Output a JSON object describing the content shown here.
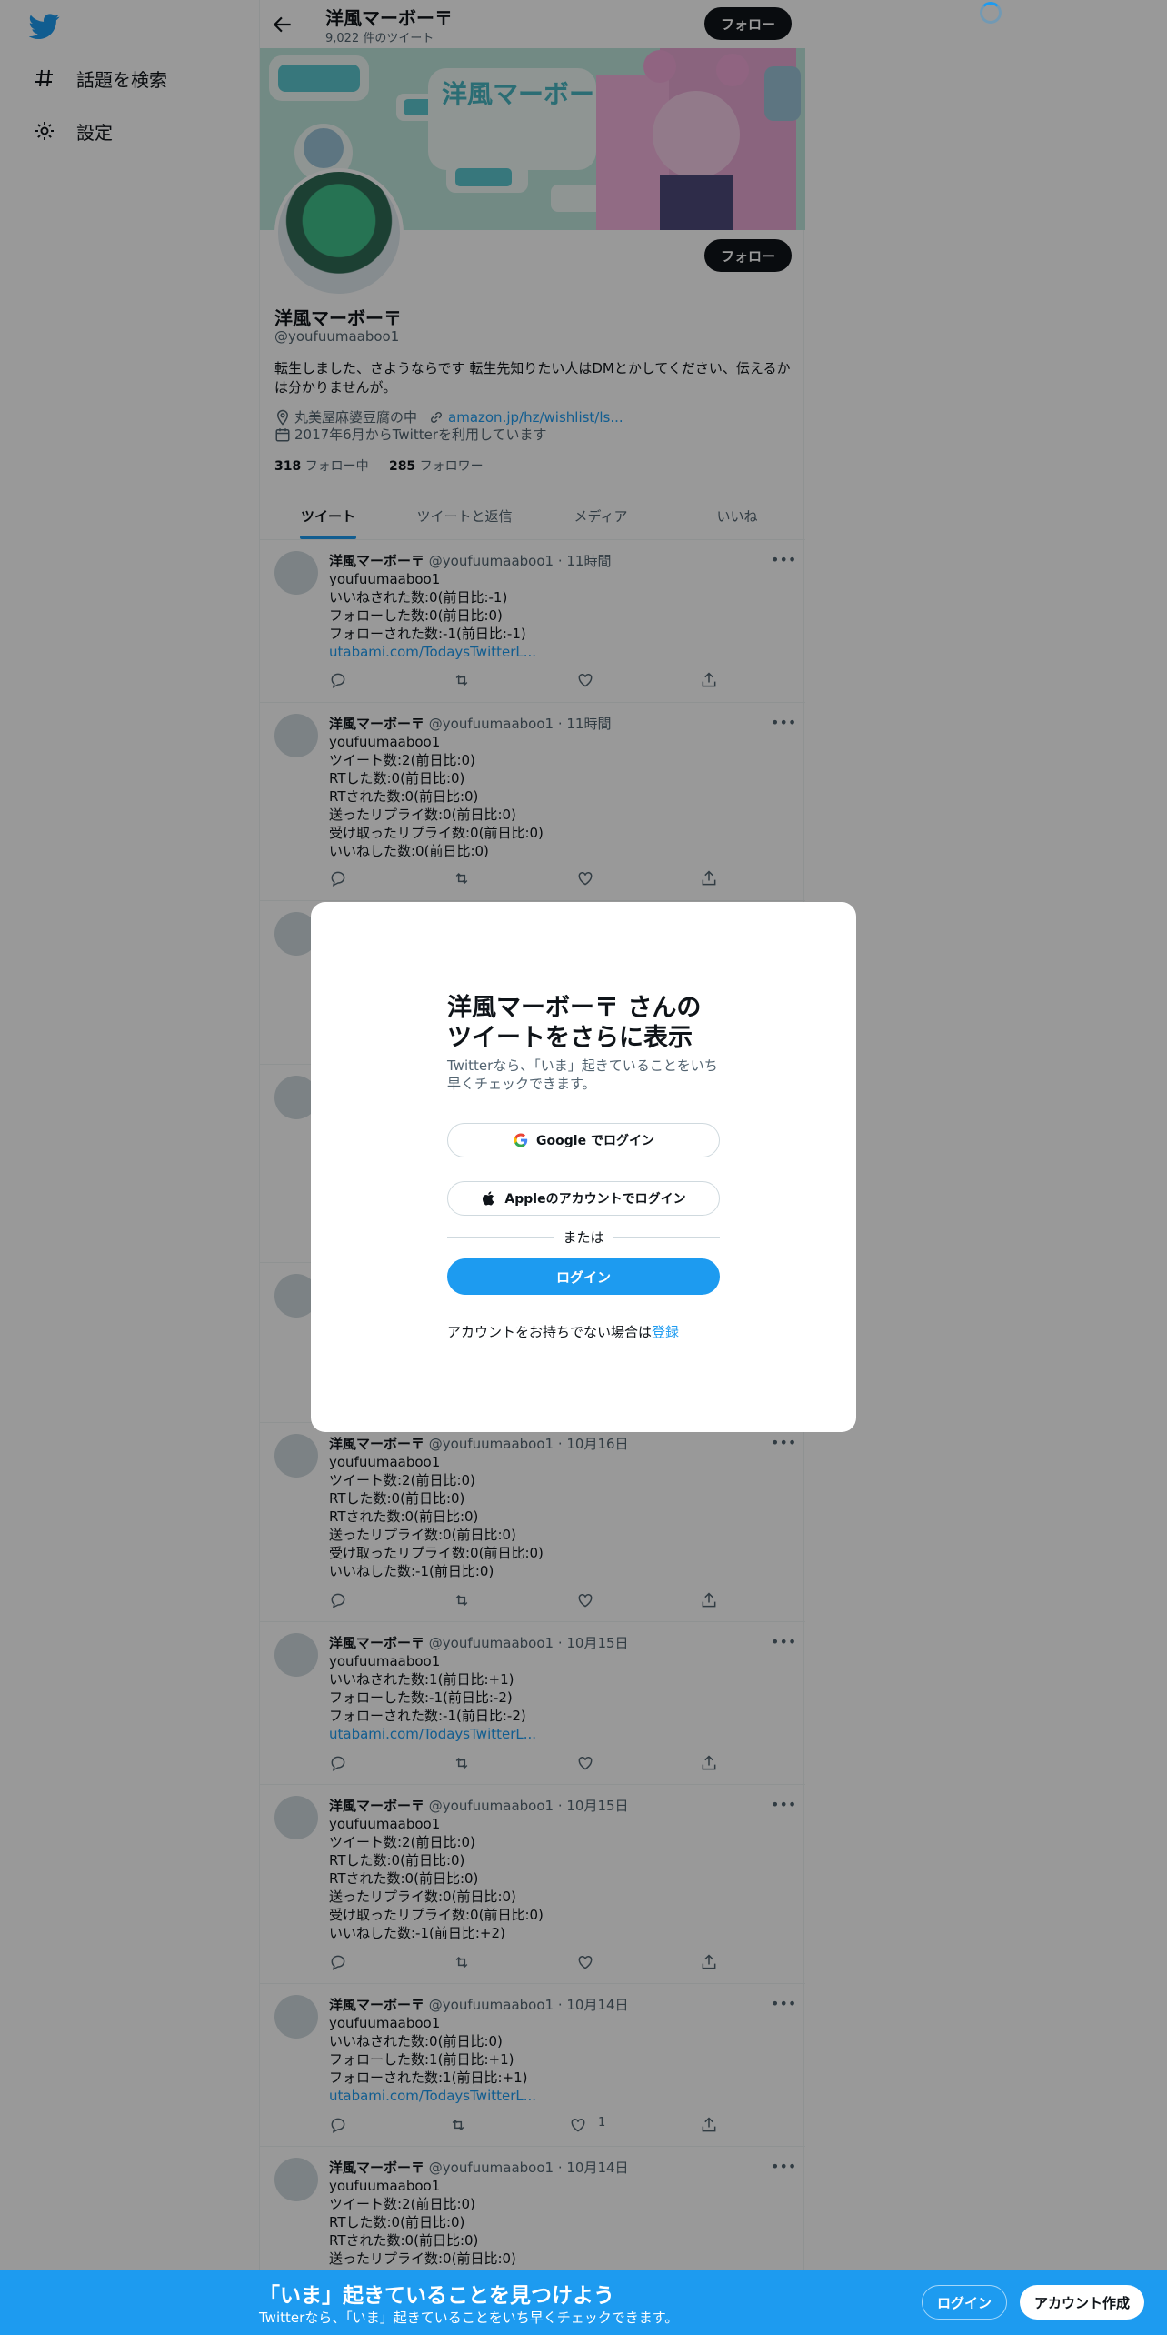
{
  "leftnav": {
    "items": [
      {
        "label": "話題を検索",
        "icon": "hashtag-icon"
      },
      {
        "label": "設定",
        "icon": "gear-icon"
      }
    ]
  },
  "topbar": {
    "name": "洋風マーボー〒",
    "tweet_count": "9,022 件のツイート",
    "follow_label": "フォロー"
  },
  "profile": {
    "name": "洋風マーボー〒",
    "handle": "@youfuumaaboo1",
    "bio": "転生しました、さようならです 転生先知りたい人はDMとかしてください、伝えるかは分かりませんが。",
    "location": "丸美屋麻婆豆腐の中",
    "link": "amazon.jp/hz/wishlist/ls...",
    "joined": "2017年6月からTwitterを利用しています",
    "following_count": "318",
    "following_label": "フォロー中",
    "followers_count": "285",
    "followers_label": "フォロワー",
    "follow_label": "フォロー",
    "banner_text": "洋風マーボー"
  },
  "tabs": [
    {
      "label": "ツイート",
      "active": true
    },
    {
      "label": "ツイートと返信",
      "active": false
    },
    {
      "label": "メディア",
      "active": false
    },
    {
      "label": "いいね",
      "active": false
    }
  ],
  "tweets": [
    {
      "name": "洋風マーボー〒",
      "meta": "@youfuumaaboo1 · 11時間",
      "lines": [
        "youfuumaaboo1",
        "いいねされた数:0(前日比:-1)",
        "フォローした数:0(前日比:0)",
        "フォローされた数:-1(前日比:-1)"
      ],
      "link": "utabami.com/TodaysTwitterL...",
      "likes": ""
    },
    {
      "name": "洋風マーボー〒",
      "meta": "@youfuumaaboo1 · 11時間",
      "lines": [
        "youfuumaaboo1",
        "ツイート数:2(前日比:0)",
        "RTした数:0(前日比:0)",
        "RTされた数:0(前日比:0)",
        "送ったリプライ数:0(前日比:0)",
        "受け取ったリプライ数:0(前日比:0)",
        "いいねした数:0(前日比:0)"
      ],
      "link": "",
      "likes": ""
    },
    {
      "name": "洋風マーボー〒",
      "meta": "@youfuumaaboo1 · 10月16日",
      "lines": [
        "youfuumaaboo1",
        "ツイート数:2(前日比:0)",
        "RTした数:0(前日比:0)",
        "RTされた数:0(前日比:0)",
        "送ったリプライ数:0(前日比:0)",
        "受け取ったリプライ数:0(前日比:0)",
        "いいねした数:-1(前日比:0)"
      ],
      "link": "",
      "likes": ""
    },
    {
      "name": "洋風マーボー〒",
      "meta": "@youfuumaaboo1 · 10月15日",
      "lines": [
        "youfuumaaboo1",
        "いいねされた数:1(前日比:+1)",
        "フォローした数:-1(前日比:-2)",
        "フォローされた数:-1(前日比:-2)"
      ],
      "link": "utabami.com/TodaysTwitterL...",
      "likes": ""
    },
    {
      "name": "洋風マーボー〒",
      "meta": "@youfuumaaboo1 · 10月15日",
      "lines": [
        "youfuumaaboo1",
        "ツイート数:2(前日比:0)",
        "RTした数:0(前日比:0)",
        "RTされた数:0(前日比:0)",
        "送ったリプライ数:0(前日比:0)",
        "受け取ったリプライ数:0(前日比:0)",
        "いいねした数:-1(前日比:+2)"
      ],
      "link": "",
      "likes": ""
    },
    {
      "name": "洋風マーボー〒",
      "meta": "@youfuumaaboo1 · 10月14日",
      "lines": [
        "youfuumaaboo1",
        "いいねされた数:0(前日比:0)",
        "フォローした数:1(前日比:+1)",
        "フォローされた数:1(前日比:+1)"
      ],
      "link": "utabami.com/TodaysTwitterL...",
      "likes": "1"
    },
    {
      "name": "洋風マーボー〒",
      "meta": "@youfuumaaboo1 · 10月14日",
      "lines": [
        "youfuumaaboo1",
        "ツイート数:2(前日比:0)",
        "RTした数:0(前日比:0)",
        "RTされた数:0(前日比:0)",
        "送ったリプライ数:0(前日比:0)"
      ],
      "link": "",
      "likes": ""
    }
  ],
  "modal": {
    "title": "洋風マーボー〒 さんのツイートをさらに表示",
    "subtitle": "Twitterなら、「いま」起きていることをいち早くチェックできます。",
    "google_label": "Google でログイン",
    "apple_label": "Appleのアカウントでログイン",
    "or_label": "または",
    "login_label": "ログイン",
    "signup_prefix": "アカウントをお持ちでない場合は",
    "signup_link": "登録"
  },
  "bottombar": {
    "title": "「いま」起きていることを見つけよう",
    "subtitle": "Twitterなら、「いま」起きていることをいち早くチェックできます。",
    "login_label": "ログイン",
    "signup_label": "アカウント作成"
  },
  "colors": {
    "accent": "#1d9bf0",
    "text": "#0f1419",
    "secondary": "#536471"
  }
}
